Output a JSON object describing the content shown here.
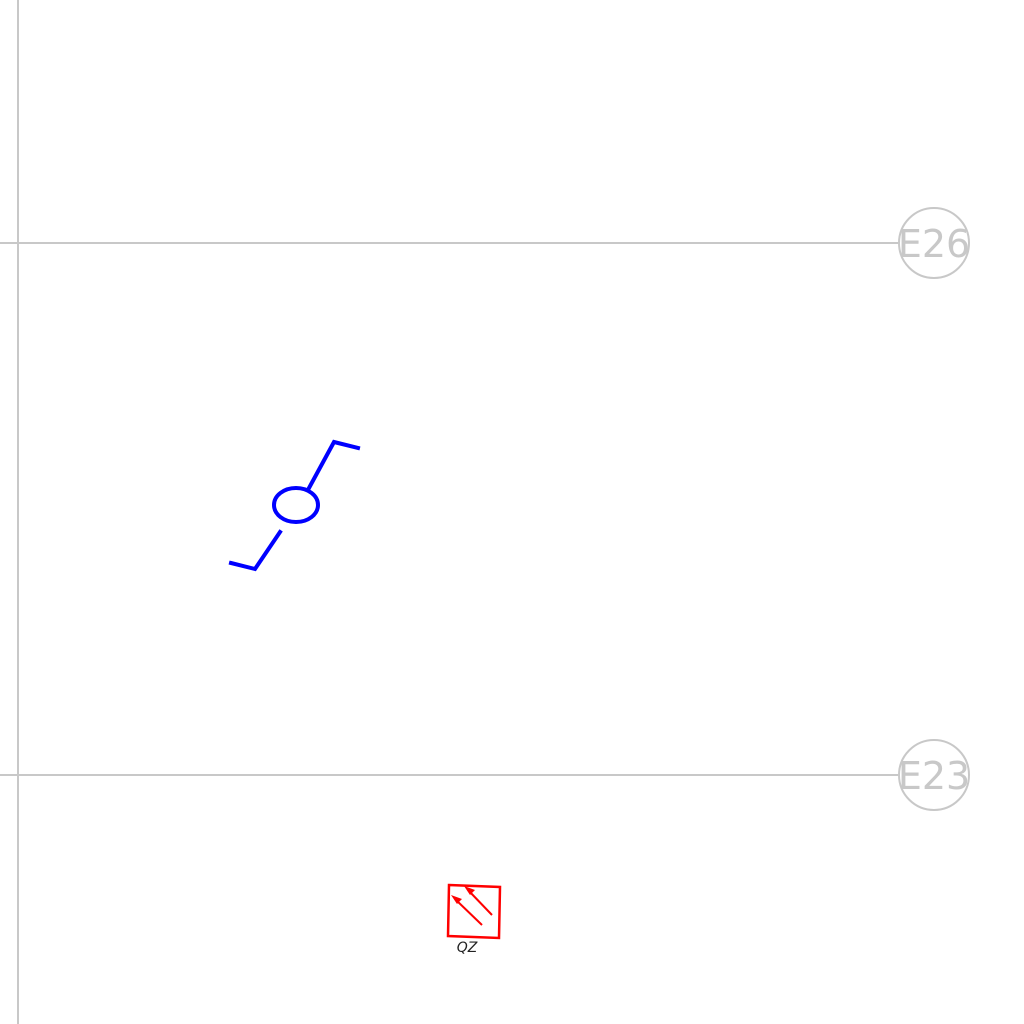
{
  "colors": {
    "grid": "#c8c8c8",
    "switch_symbol": "#0000ff",
    "device_symbol": "#ff0000",
    "label_text": "#222222",
    "background": "#ffffff"
  },
  "grid_bubbles": [
    {
      "id": "grid-e26",
      "label": "E26"
    },
    {
      "id": "grid-e23",
      "label": "E23"
    }
  ],
  "symbols": {
    "switch": {
      "icon": "two-way-switch-icon"
    },
    "device": {
      "icon": "double-arrow-box-icon",
      "label": "QZ"
    }
  }
}
